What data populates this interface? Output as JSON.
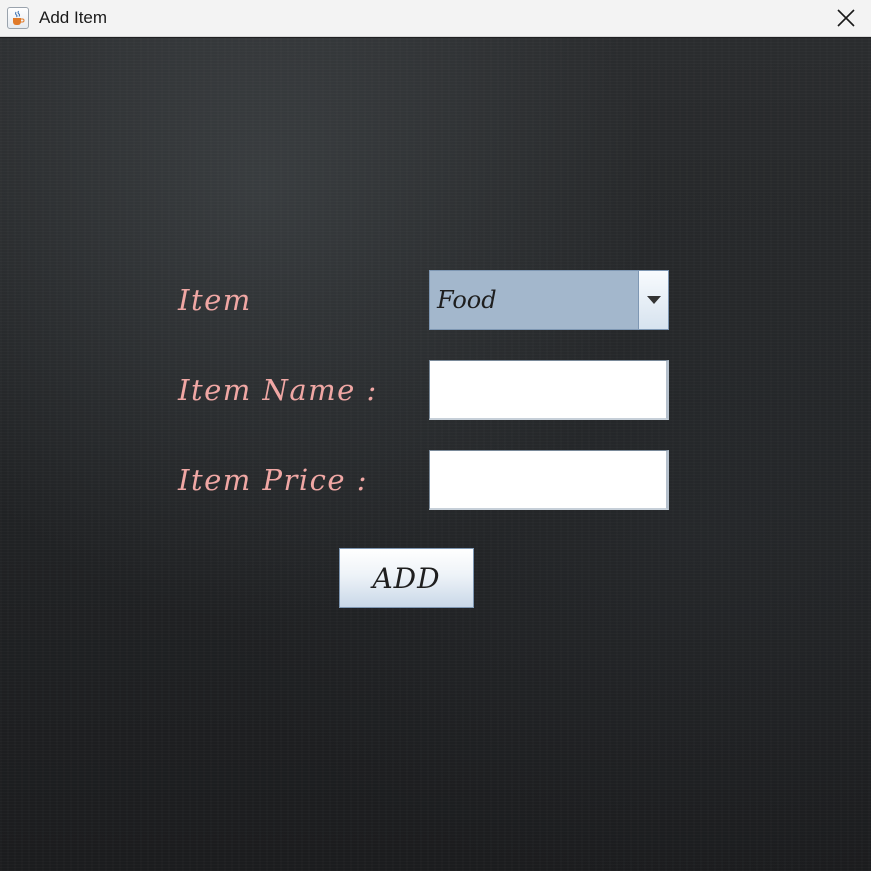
{
  "window": {
    "title": "Add Item",
    "icon": "java-cup-icon",
    "close_icon": "close-icon"
  },
  "form": {
    "item_label": "Item",
    "item_combo_value": "Food",
    "item_name_label": "Item  Name :",
    "item_name_value": "",
    "item_price_label": "Item  Price :",
    "item_price_value": "",
    "add_button_label": "ADD"
  },
  "colors": {
    "label_color": "#f0a7a4",
    "combo_bg": "#a3b7cc",
    "background": "#1f2022"
  }
}
